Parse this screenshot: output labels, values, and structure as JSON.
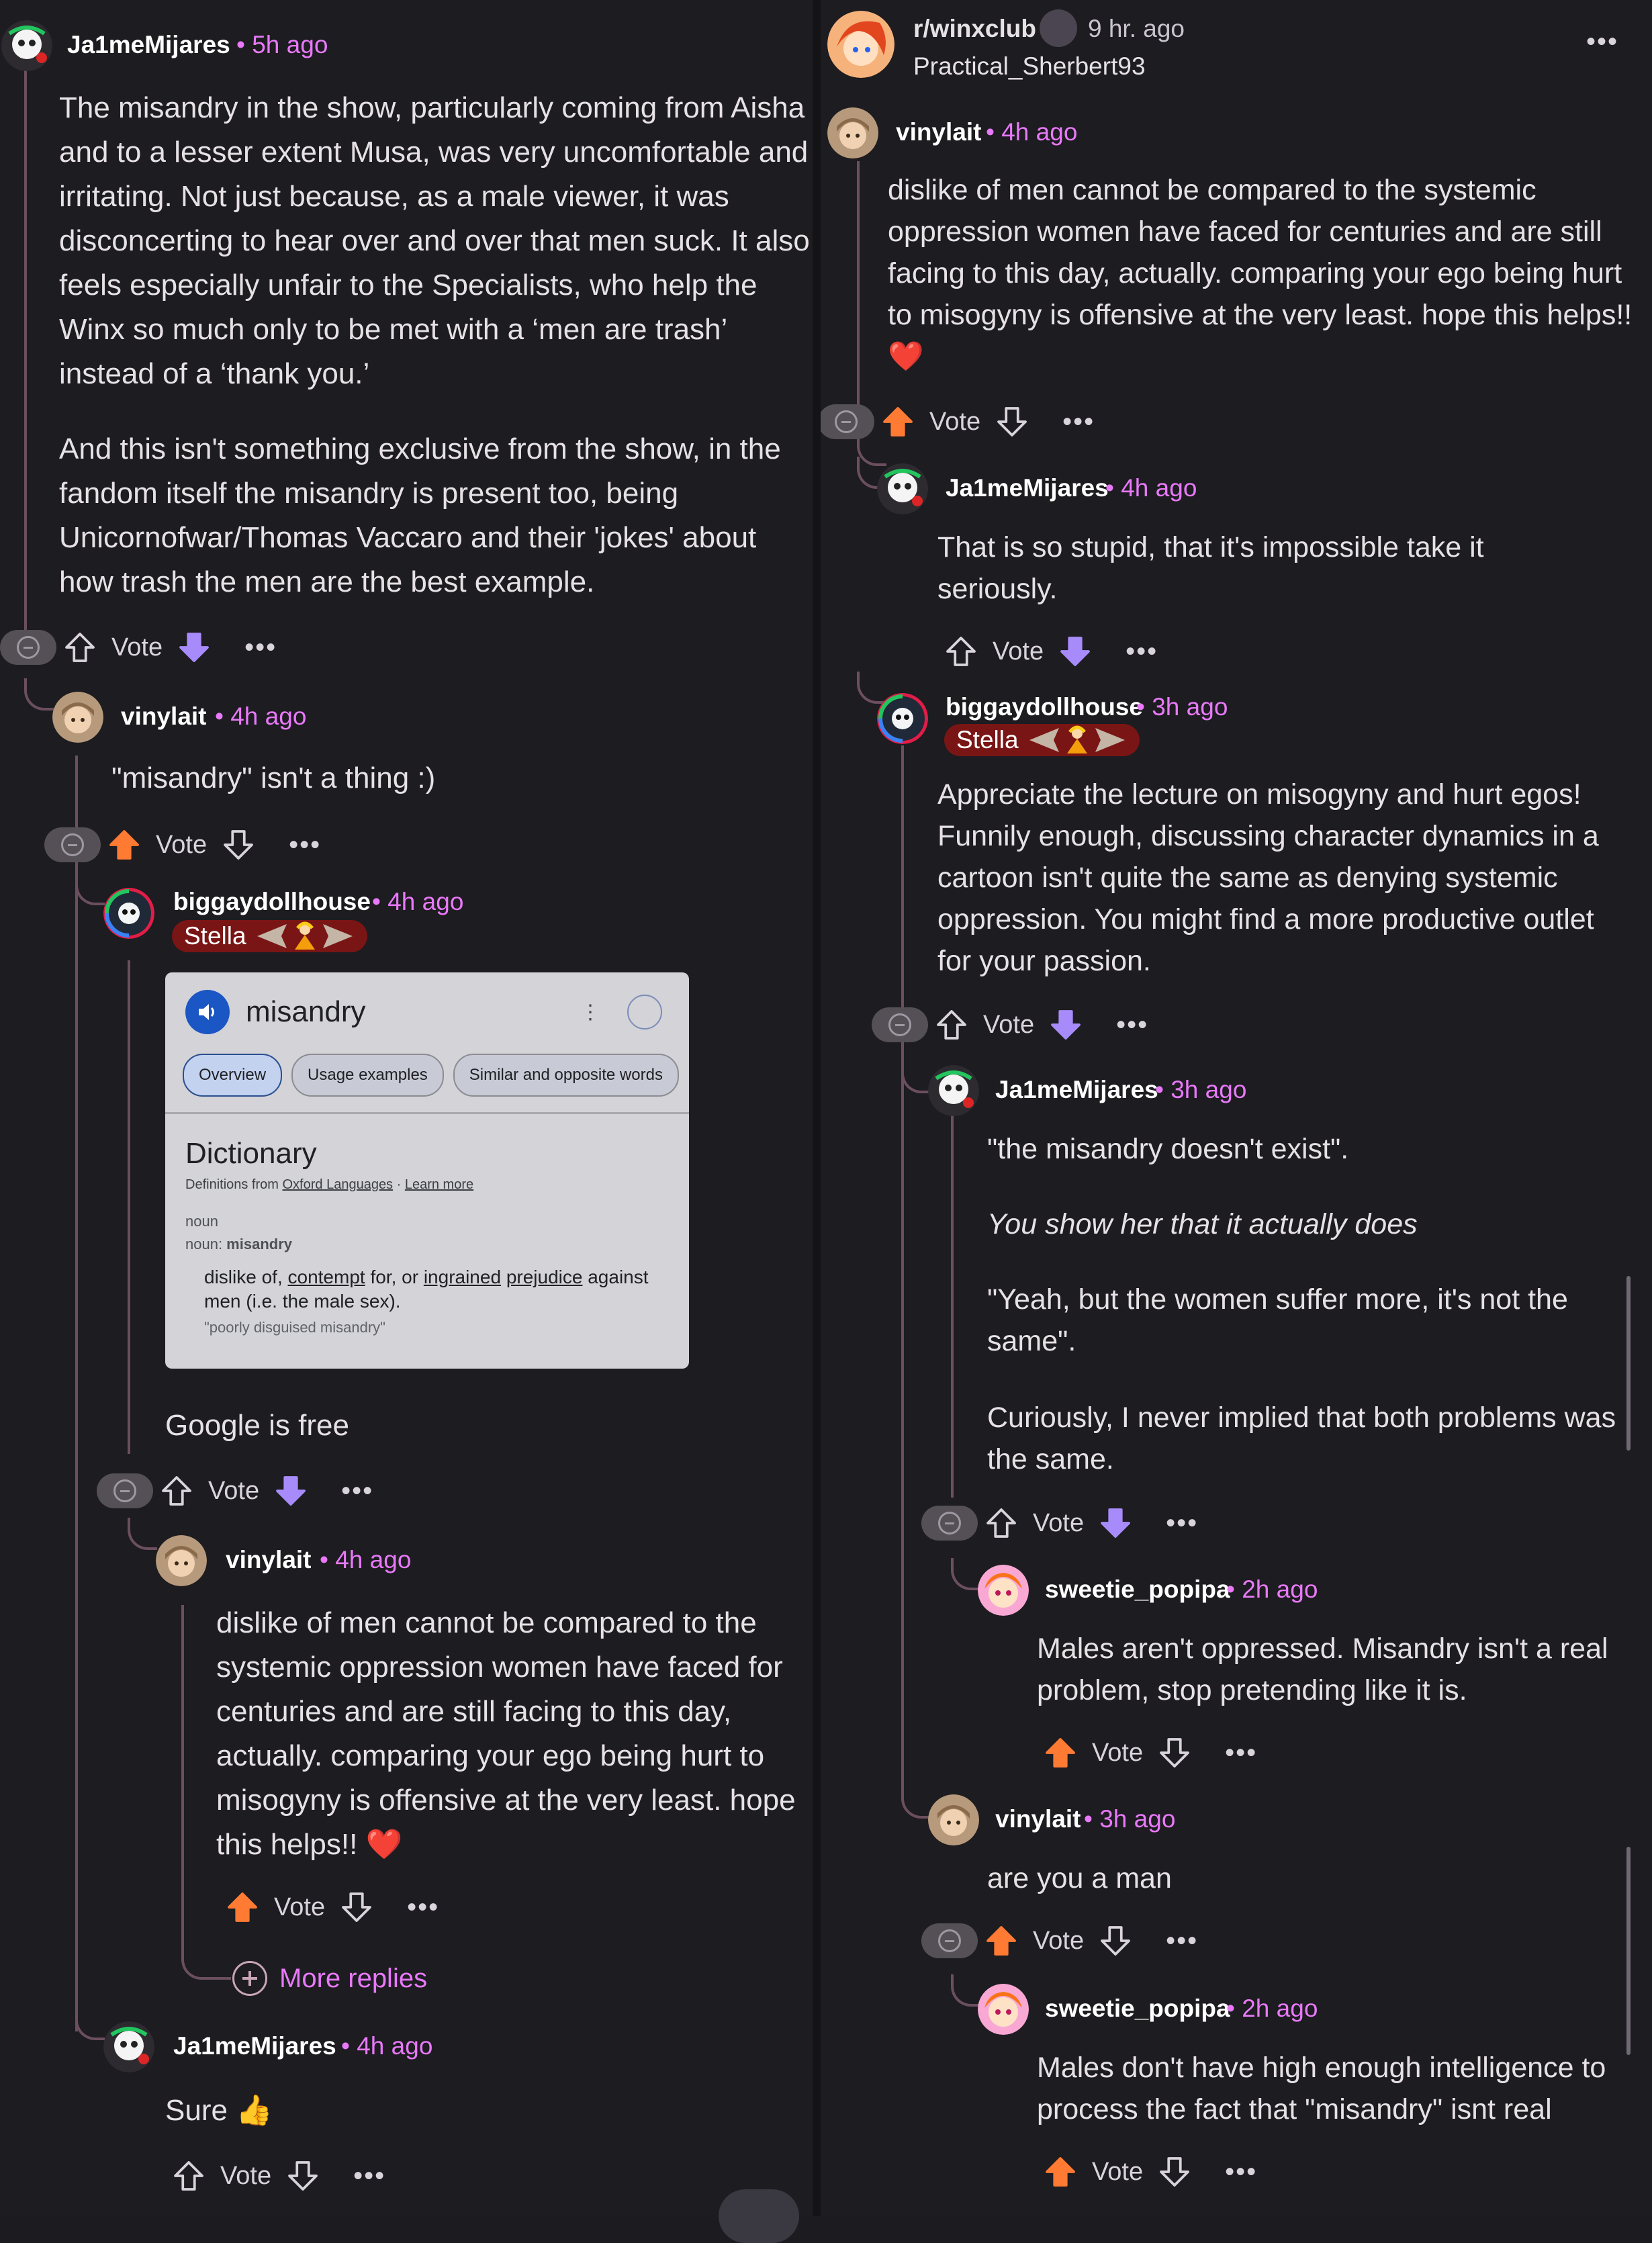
{
  "header": {
    "subreddit": "r/winxclub",
    "time": "9 hr. ago",
    "op_user": "Practical_Sherbert93",
    "more_icon": "overflow-menu-icon"
  },
  "common": {
    "vote_label": "Vote",
    "dots": "•••",
    "more_replies": "More replies",
    "upvote_active_color": "#ff7a33",
    "downvote_active_color": "#a78bfa"
  },
  "left": {
    "c1": {
      "user": "Ja1meMijares",
      "time": "• 5h ago",
      "p1": "The misandry in the show, particularly coming from Aisha and to a lesser extent Musa, was very uncomfortable and irritating. Not just because, as a male viewer, it was disconcerting to hear over and over that men suck. It also feels especially unfair to the Specialists, who help the Winx so much only to be met with a ‘men are trash’ instead of a ‘thank you.’",
      "p2": "And this isn't something exclusive from the show, in the fandom itself the misandry is present too, being Unicornofwar/Thomas Vaccaro and their 'jokes' about how trash the men are the best example."
    },
    "c2": {
      "user": "vinylait",
      "time": "• 4h ago",
      "text": "\"misandry\" isn't a thing :)"
    },
    "c3": {
      "user": "biggaydollhouse",
      "time": "• 4h ago",
      "flair": "Stella",
      "text": "Google is free",
      "dict": {
        "word": "misandry",
        "tabs": [
          "Overview",
          "Usage examples",
          "Similar and opposite words"
        ],
        "title": "Dictionary",
        "source_prefix": "Definitions from ",
        "source": "Oxford Languages",
        "learn_more": "Learn more",
        "pos": "noun",
        "pos2_label": "noun: ",
        "pos2_word": "misandry",
        "def_a": "dislike of, ",
        "def_contempt": "contempt",
        "def_b": " for, or ",
        "def_ingrained": "ingrained",
        "def_c": " ",
        "def_prejudice": "prejudice",
        "def_d": " against men (i.e. the male sex).",
        "example": "\"poorly disguised misandry\""
      }
    },
    "c4": {
      "user": "vinylait",
      "time": "• 4h ago",
      "text": "dislike of men cannot be compared to the systemic oppression women have faced for centuries and are still facing to this day, actually. comparing your ego being hurt to misogyny is offensive at the very least. hope this helps!! ❤️"
    },
    "c5": {
      "user": "Ja1meMijares",
      "time": "• 4h ago",
      "text": "Sure 👍"
    }
  },
  "right": {
    "c1": {
      "user": "vinylait",
      "time": "• 4h ago",
      "text": "dislike of men cannot be compared to the systemic oppression women have faced for centuries and are still facing to this day, actually. comparing your ego being hurt to misogyny is offensive at the very least. hope this helps!! ❤️"
    },
    "c2": {
      "user": "Ja1meMijares",
      "time": "• 4h ago",
      "text": "That is so stupid, that it's impossible take it seriously."
    },
    "c3": {
      "user": "biggaydollhouse",
      "time": "• 3h ago",
      "flair": "Stella",
      "text": "Appreciate the lecture on misogyny and hurt egos! Funnily enough, discussing character dynamics in a cartoon isn't quite the same as denying systemic oppression. You might find a more productive outlet for your passion."
    },
    "c4": {
      "user": "Ja1meMijares",
      "time": "• 3h ago",
      "p1": "\"the misandry doesn't exist\".",
      "p2": "You show her that it actually does",
      "p3": "\"Yeah, but the women suffer more, it's not the same\".",
      "p4": "Curiously, I never implied that both problems was the same."
    },
    "c5": {
      "user": "sweetie_popipa",
      "time": "• 2h ago",
      "text": "Males aren't oppressed. Misandry isn't a real problem, stop pretending like it is."
    },
    "c6": {
      "user": "vinylait",
      "time": "• 3h ago",
      "text": "are you a man"
    },
    "c7": {
      "user": "sweetie_popipa",
      "time": "• 2h ago",
      "text": "Males don't have high enough intelligence to process the fact that \"misandry\" isnt real"
    }
  }
}
